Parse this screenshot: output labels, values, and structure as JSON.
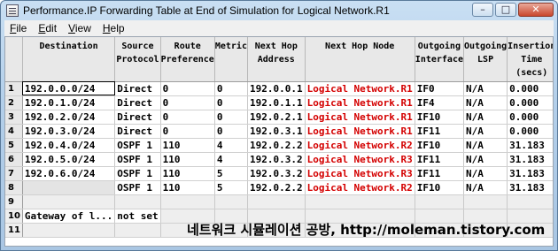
{
  "window": {
    "title": "Performance.IP Forwarding Table at End of Simulation for Logical Network.R1",
    "minimize_glyph": "–",
    "maximize_glyph": "□",
    "close_glyph": "✕"
  },
  "menu": [
    {
      "accel": "F",
      "rest": "ile"
    },
    {
      "accel": "E",
      "rest": "dit"
    },
    {
      "accel": "V",
      "rest": "iew"
    },
    {
      "accel": "H",
      "rest": "elp"
    }
  ],
  "columns": [
    [
      "Destination"
    ],
    [
      "Source",
      "Protocol"
    ],
    [
      "Route",
      "Preference"
    ],
    [
      "Metric"
    ],
    [
      "Next Hop",
      "Address"
    ],
    [
      "Next Hop Node"
    ],
    [
      "Outgoing",
      "Interface"
    ],
    [
      "Outgoing",
      "LSP"
    ],
    [
      "Insertion",
      "Time",
      "(secs)"
    ]
  ],
  "rows": [
    {
      "num": "1",
      "cells": [
        "192.0.0.0/24",
        "Direct",
        "0",
        "0",
        "192.0.0.1",
        "Logical Network.R1",
        "IF0",
        "N/A",
        "0.000"
      ]
    },
    {
      "num": "2",
      "cells": [
        "192.0.1.0/24",
        "Direct",
        "0",
        "0",
        "192.0.1.1",
        "Logical Network.R1",
        "IF4",
        "N/A",
        "0.000"
      ]
    },
    {
      "num": "3",
      "cells": [
        "192.0.2.0/24",
        "Direct",
        "0",
        "0",
        "192.0.2.1",
        "Logical Network.R1",
        "IF10",
        "N/A",
        "0.000"
      ]
    },
    {
      "num": "4",
      "cells": [
        "192.0.3.0/24",
        "Direct",
        "0",
        "0",
        "192.0.3.1",
        "Logical Network.R1",
        "IF11",
        "N/A",
        "0.000"
      ]
    },
    {
      "num": "5",
      "cells": [
        "192.0.4.0/24",
        "OSPF 1",
        "110",
        "4",
        "192.0.2.2",
        "Logical Network.R2",
        "IF10",
        "N/A",
        "31.183"
      ]
    },
    {
      "num": "6",
      "cells": [
        "192.0.5.0/24",
        "OSPF 1",
        "110",
        "4",
        "192.0.3.2",
        "Logical Network.R3",
        "IF11",
        "N/A",
        "31.183"
      ]
    },
    {
      "num": "7",
      "cells": [
        "192.0.6.0/24",
        "OSPF 1",
        "110",
        "5",
        "192.0.3.2",
        "Logical Network.R3",
        "IF11",
        "N/A",
        "31.183"
      ]
    },
    {
      "num": "8",
      "cells": [
        "",
        "OSPF 1",
        "110",
        "5",
        "192.0.2.2",
        "Logical Network.R2",
        "IF10",
        "N/A",
        "31.183"
      ]
    },
    {
      "num": "9",
      "cells": [
        "",
        "",
        "",
        "",
        "",
        "",
        "",
        "",
        ""
      ]
    },
    {
      "num": "10",
      "cells": [
        "Gateway of l...",
        "not set",
        "",
        "",
        "",
        "",
        "",
        "",
        ""
      ]
    },
    {
      "num": "11",
      "cells": [
        "",
        "",
        "",
        "",
        "",
        "",
        "",
        "",
        ""
      ]
    }
  ],
  "watermark": "네트워크 시뮬레이션 공방, http://moleman.tistory.com"
}
